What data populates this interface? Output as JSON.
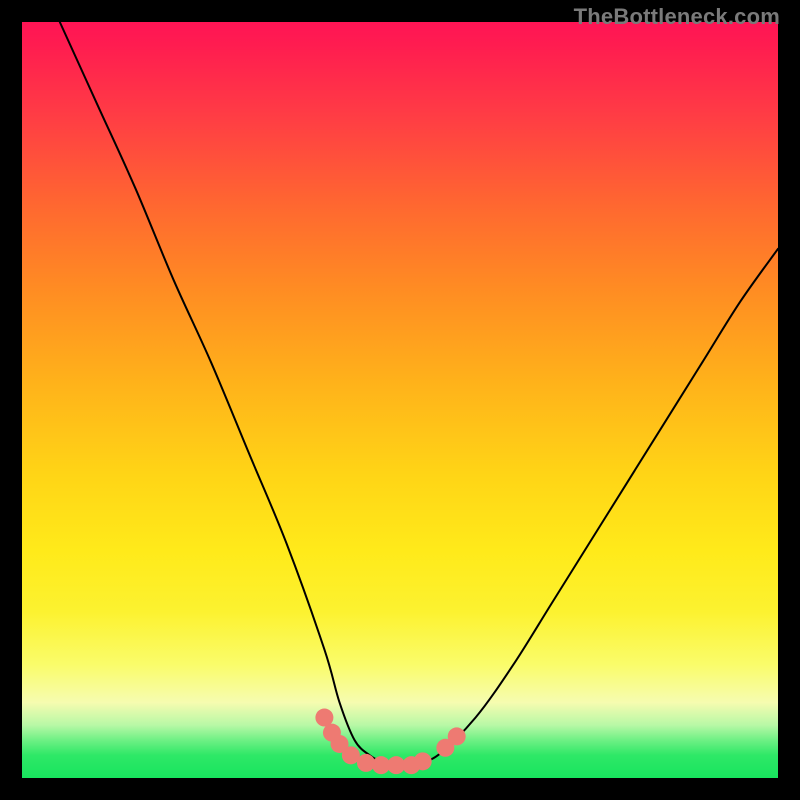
{
  "watermark": {
    "text": "TheBottleneck.com"
  },
  "chart_data": {
    "type": "line",
    "title": "",
    "xlabel": "",
    "ylabel": "",
    "xlim": [
      0,
      100
    ],
    "ylim": [
      0,
      100
    ],
    "grid": false,
    "note": "Axes are unlabeled; curve is a V-shaped bottleneck profile. x/y are normalized 0-100 across the gradient plot area; y=100 is top (red), y=0 is bottom (green). Values estimated from pixel positions.",
    "series": [
      {
        "name": "bottleneck-curve",
        "stroke": "#000000",
        "x": [
          5,
          10,
          15,
          20,
          25,
          30,
          35,
          40,
          42,
          44,
          46,
          48,
          50,
          52,
          55,
          60,
          65,
          70,
          75,
          80,
          85,
          90,
          95,
          100
        ],
        "y": [
          100,
          89,
          78,
          66,
          55,
          43,
          31,
          17,
          10,
          5,
          3,
          2,
          2,
          2,
          3,
          8,
          15,
          23,
          31,
          39,
          47,
          55,
          63,
          70
        ]
      }
    ],
    "markers": {
      "name": "bottom-dots",
      "color": "#ee7a72",
      "radius_px": 9,
      "note": "Cluster of salmon dots near curve minimum; positions in same 0-100 normalized space.",
      "points": [
        {
          "x": 40.0,
          "y": 8.0
        },
        {
          "x": 41.0,
          "y": 6.0
        },
        {
          "x": 42.0,
          "y": 4.5
        },
        {
          "x": 43.5,
          "y": 3.0
        },
        {
          "x": 45.5,
          "y": 2.0
        },
        {
          "x": 47.5,
          "y": 1.7
        },
        {
          "x": 49.5,
          "y": 1.7
        },
        {
          "x": 51.5,
          "y": 1.7
        },
        {
          "x": 53.0,
          "y": 2.2
        },
        {
          "x": 56.0,
          "y": 4.0
        },
        {
          "x": 57.5,
          "y": 5.5
        }
      ]
    }
  }
}
